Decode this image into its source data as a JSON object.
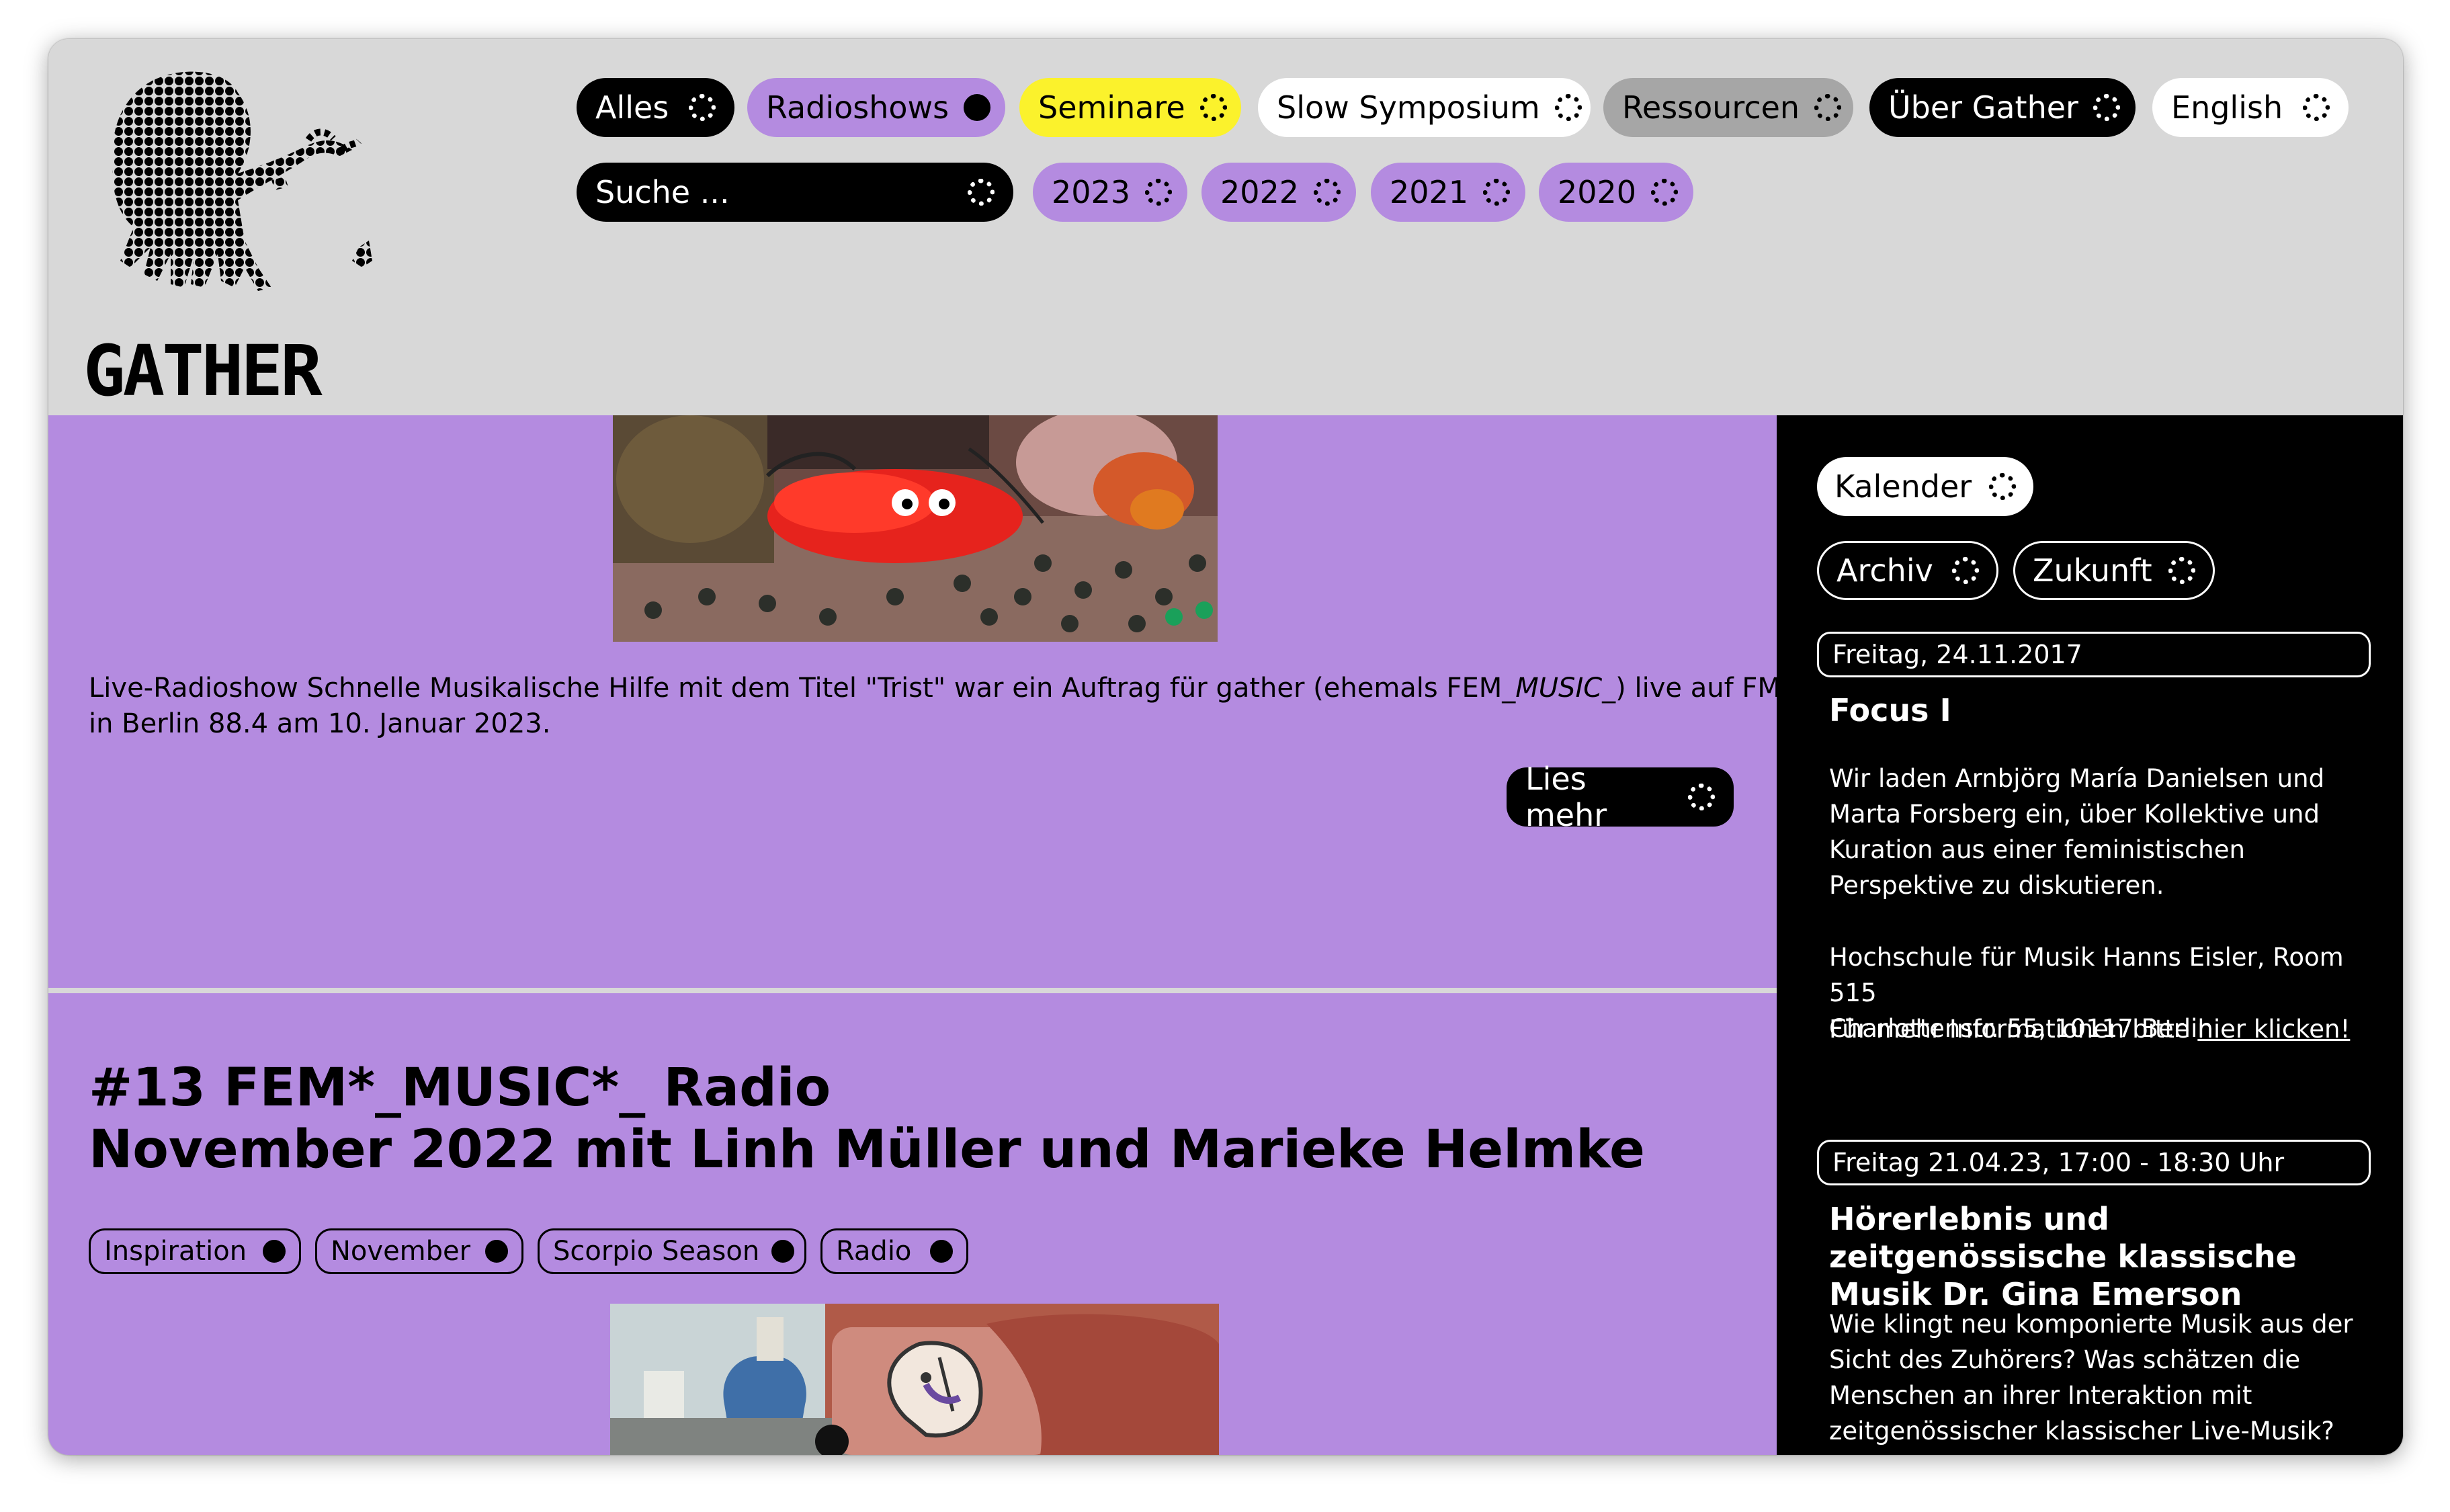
{
  "site": {
    "logo_text": "GATHER"
  },
  "nav": {
    "row1": [
      {
        "label": "Alles",
        "style": "black"
      },
      {
        "label": "Radioshows",
        "style": "purple",
        "filled": true
      },
      {
        "label": "Seminare",
        "style": "yellow"
      },
      {
        "label": "Slow Symposium",
        "style": "white"
      },
      {
        "label": "Ressourcen",
        "style": "gray"
      },
      {
        "label": "Über Gather",
        "style": "black"
      },
      {
        "label": "English",
        "style": "white"
      }
    ],
    "search_placeholder": "Suche ...",
    "years": [
      "2023",
      "2022",
      "2021",
      "2020"
    ]
  },
  "post1": {
    "description_prefix": "Live-Radioshow Schnelle Musikalische Hilfe mit dem Titel \"Trist\" war ein Auftrag für gather (ehemals FEM_",
    "description_italic": "MUSIC",
    "description_suffix": "_) live auf FM in Berlin 88.4 am 10. Januar 2023.",
    "read_more": "Lies mehr"
  },
  "post2": {
    "title_line1": "#13 FEM*_MUSIC*_ Radio",
    "title_line2": "November 2022 mit Linh Müller und Marieke Helmke",
    "tags": [
      "Inspiration",
      "November",
      "Scorpio Season",
      "Radio"
    ]
  },
  "sidebar": {
    "calendar_label": "Kalender",
    "archive_label": "Archiv",
    "future_label": "Zukunft",
    "events": [
      {
        "date": "Freitag, 24.11.2017",
        "title": "Focus I",
        "text": "Wir laden Arnbjörg María Danielsen und Marta Forsberg ein, über Kollektive und Kuration aus einer feministischen Perspektive zu diskutieren.",
        "location_line1": "Hochschule für Musik Hanns Eisler, Room 515",
        "location_line2": "Charlottenstr. 55, 10117 Berlin",
        "more_prefix": "Für mehr Informationen bitte ",
        "more_link": "hier klicken!"
      },
      {
        "date": "Freitag 21.04.23, 17:00 - 18:30 Uhr",
        "title": "Hörerlebnis und zeitgenössische klassische Musik Dr. Gina Emerson",
        "text": "Wie klingt neu komponierte Musik aus der Sicht des Zuhörers? Was schätzen die Menschen an ihrer Interaktion mit zeitgenössischer klassischer Live-Musik?"
      }
    ]
  },
  "colors": {
    "header_bg": "#d8d8d8",
    "main_bg": "#b48be0",
    "accent_yellow": "#fbf22c",
    "sidebar_bg": "#000000"
  }
}
